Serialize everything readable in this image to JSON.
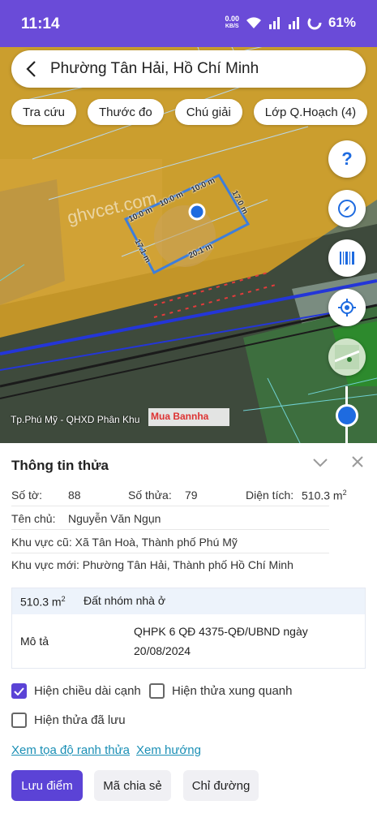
{
  "status_bar": {
    "time": "11:14",
    "net_speed": "0.00",
    "net_unit": "KB/S",
    "battery": "61%"
  },
  "search": {
    "title": "Phường Tân Hải, Hồ Chí Minh"
  },
  "chips": [
    "Tra cứu",
    "Thước đo",
    "Chú giải",
    "Lớp Q.Hoạch (4)"
  ],
  "map": {
    "watermark": "ghvcet.com",
    "layer_label": "Tp.Phú Mỹ - QHXD Phân Khu",
    "brand": "Mua Bannha",
    "dimensions": [
      "10.0 m",
      "10.0 m",
      "10.0 m",
      "17.0 m",
      "20.1 m",
      "17.1 m"
    ]
  },
  "sheet": {
    "title": "Thông tin thửa",
    "so_to_label": "Số tờ:",
    "so_to": "88",
    "so_thua_label": "Số thửa:",
    "so_thua": "79",
    "dien_tich_label": "Diện tích:",
    "dien_tich": "510.3 m",
    "chu_label": "Tên chủ:",
    "chu": "Nguyễn Văn Ngụn",
    "kv_cu_label": "Khu vực cũ:",
    "kv_cu": "Xã Tân Hoà, Thành phố Phú Mỹ",
    "kv_moi_label": "Khu vực mới:",
    "kv_moi": "Phường Tân Hải, Thành phố Hồ Chí Minh",
    "box_area": "510.3 m",
    "box_type": "Đất nhóm nhà ở",
    "mo_ta_label": "Mô tả",
    "mo_ta_line1": "QHPK 6 QĐ 4375-QĐ/UBND ngày",
    "mo_ta_line2": "20/08/2024",
    "check1": "Hiện chiều dài cạnh",
    "check2": "Hiện thửa xung quanh",
    "check3": "Hiện thửa đã lưu",
    "link1": "Xem tọa độ ranh thửa",
    "link2": "Xem hướng",
    "btn_save": "Lưu điểm",
    "btn_share": "Mã chia sẻ",
    "btn_route": "Chỉ đường"
  },
  "colors": {
    "accent": "#5b43d6",
    "statusbar": "#6a4bd8",
    "land_orange": "#e0a623",
    "link": "#1a8fb5"
  }
}
